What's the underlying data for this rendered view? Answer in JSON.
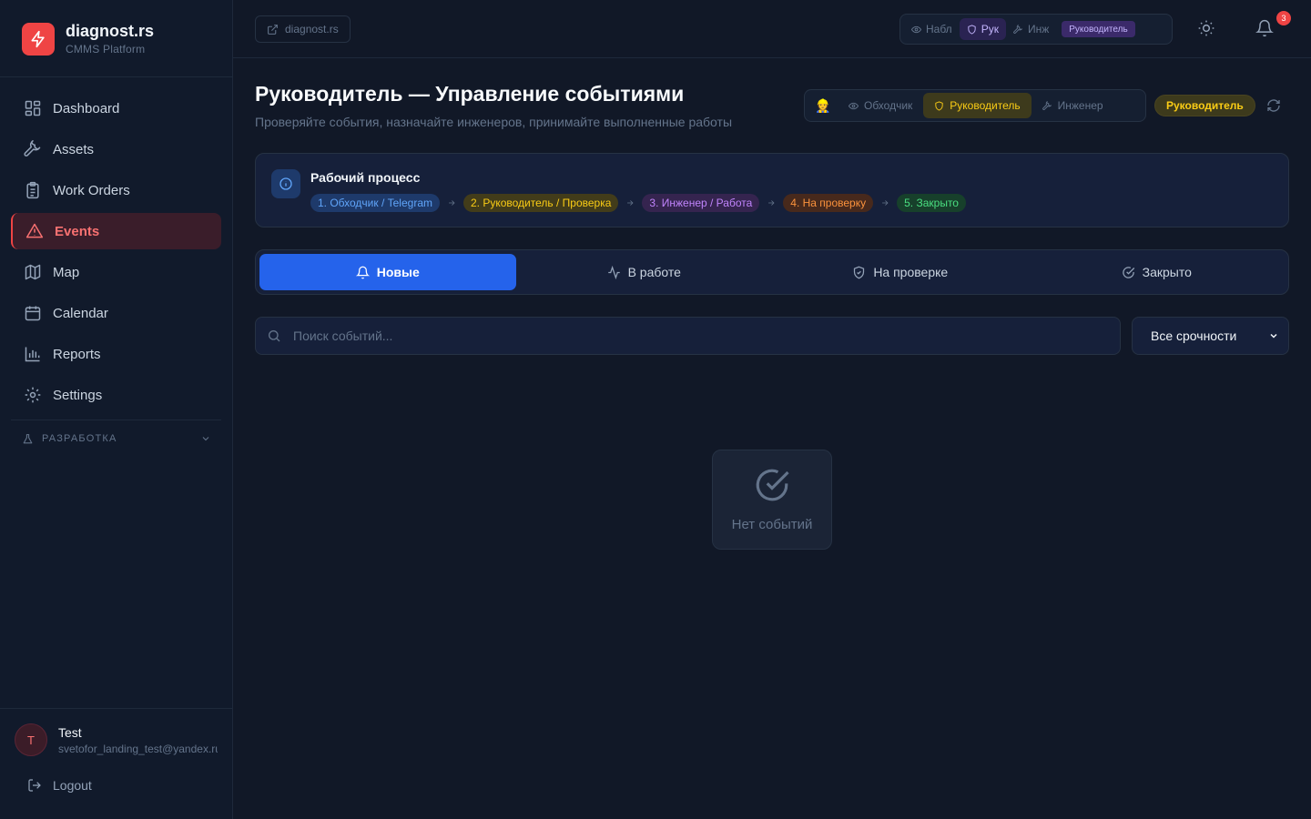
{
  "app": {
    "name": "diagnost.rs",
    "subtitle": "CMMS Platform"
  },
  "sidebar": {
    "items": [
      {
        "label": "Dashboard",
        "icon": "grid-icon"
      },
      {
        "label": "Assets",
        "icon": "wrench-icon"
      },
      {
        "label": "Work Orders",
        "icon": "clipboard-icon"
      },
      {
        "label": "Events",
        "icon": "alert-triangle-icon",
        "active": true
      },
      {
        "label": "Map",
        "icon": "map-icon"
      },
      {
        "label": "Calendar",
        "icon": "calendar-icon"
      },
      {
        "label": "Reports",
        "icon": "bar-chart-icon"
      },
      {
        "label": "Settings",
        "icon": "gear-icon"
      }
    ],
    "dev_section": "РАЗРАБОТКА"
  },
  "user": {
    "initial": "T",
    "name": "Test",
    "email": "svetofor_landing_test@yandex.ru",
    "logout_label": "Logout"
  },
  "topbar": {
    "site_link": "diagnost.rs",
    "role_switch": {
      "observer": "Набл",
      "manager": "Рук",
      "engineer": "Инж",
      "badge": "Руководитель"
    },
    "notifications_count": "3"
  },
  "page": {
    "title": "Руководитель — Управление событиями",
    "subtitle": "Проверяйте события, назначайте инженеров, принимайте выполненные работы",
    "view_switch": {
      "emoji": "👷",
      "walker": "Обходчик",
      "manager": "Руководитель",
      "engineer": "Инженер"
    },
    "role_pill": "Руководитель"
  },
  "workflow": {
    "title": "Рабочий процесс",
    "steps": [
      {
        "label": "1. Обходчик / Telegram",
        "color": "#60a5fa"
      },
      {
        "label": "2. Руководитель / Проверка",
        "color": "#facc15"
      },
      {
        "label": "3. Инженер / Работа",
        "color": "#c084fc"
      },
      {
        "label": "4. На проверку",
        "color": "#fb923c"
      },
      {
        "label": "5. Закрыто",
        "color": "#4ade80"
      }
    ]
  },
  "tabs": [
    {
      "label": "Новые",
      "icon": "bell-icon",
      "active": true
    },
    {
      "label": "В работе",
      "icon": "activity-icon"
    },
    {
      "label": "На проверке",
      "icon": "shield-check-icon"
    },
    {
      "label": "Закрыто",
      "icon": "check-circle-icon"
    }
  ],
  "filters": {
    "search_placeholder": "Поиск событий...",
    "urgency_selected": "Все срочности"
  },
  "empty_state": {
    "text": "Нет событий"
  },
  "colors": {
    "accent": "#2563eb",
    "brand": "#ef4444",
    "manager": "#facc15"
  }
}
